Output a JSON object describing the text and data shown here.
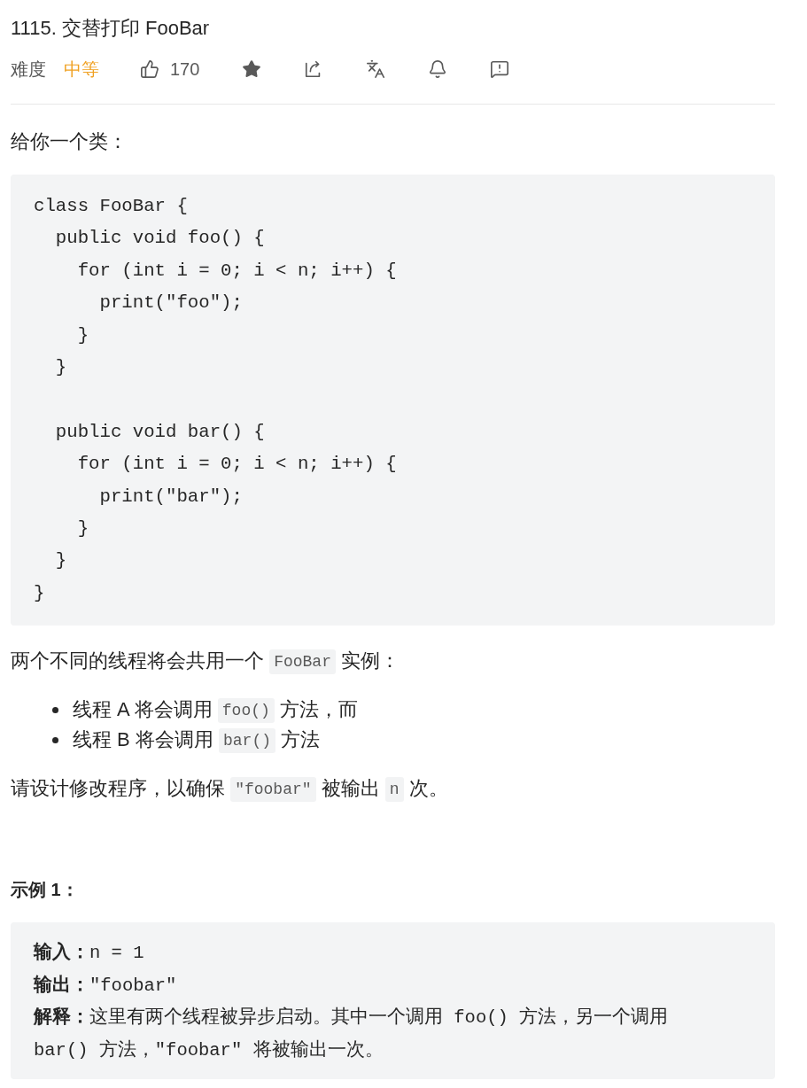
{
  "problem": {
    "title": "1115. 交替打印 FooBar"
  },
  "meta": {
    "difficulty_label": "难度",
    "difficulty": {
      "text": "中等",
      "kind": "medium"
    },
    "likes": "170"
  },
  "description": [
    {
      "kind": "paragraph",
      "segments": [
        {
          "kind": "text",
          "text": "给你一个类："
        }
      ]
    },
    {
      "kind": "code",
      "code": "class FooBar {\n  public void foo() {\n    for (int i = 0; i < n; i++) {\n      print(\"foo\");\n    }\n  }\n\n  public void bar() {\n    for (int i = 0; i < n; i++) {\n      print(\"bar\");\n    }\n  }\n}"
    },
    {
      "kind": "paragraph",
      "segments": [
        {
          "kind": "text",
          "text": "两个不同的线程将会共用一个 "
        },
        {
          "kind": "code",
          "text": "FooBar"
        },
        {
          "kind": "text",
          "text": " 实例："
        }
      ]
    },
    {
      "kind": "list",
      "items": [
        {
          "segments": [
            {
              "kind": "text",
              "text": "线程 A 将会调用 "
            },
            {
              "kind": "code",
              "text": "foo()"
            },
            {
              "kind": "text",
              "text": " 方法，而"
            }
          ]
        },
        {
          "segments": [
            {
              "kind": "text",
              "text": "线程 B 将会调用 "
            },
            {
              "kind": "code",
              "text": "bar()"
            },
            {
              "kind": "text",
              "text": " 方法"
            }
          ]
        }
      ]
    },
    {
      "kind": "paragraph",
      "segments": [
        {
          "kind": "text",
          "text": "请设计修改程序，以确保 "
        },
        {
          "kind": "code",
          "text": "\"foobar\""
        },
        {
          "kind": "text",
          "text": " 被输出 "
        },
        {
          "kind": "code",
          "text": "n"
        },
        {
          "kind": "text",
          "text": " 次。"
        }
      ]
    },
    {
      "kind": "heading",
      "text": "示例 1："
    },
    {
      "kind": "example",
      "lines": [
        "**输入：**n = 1",
        "**输出：**\"foobar\"",
        "**解释：**这里有两个线程被异步启动。其中一个调用 foo() 方法，另一个调用",
        "bar() 方法，\"foobar\" 将被输出一次。"
      ]
    }
  ]
}
